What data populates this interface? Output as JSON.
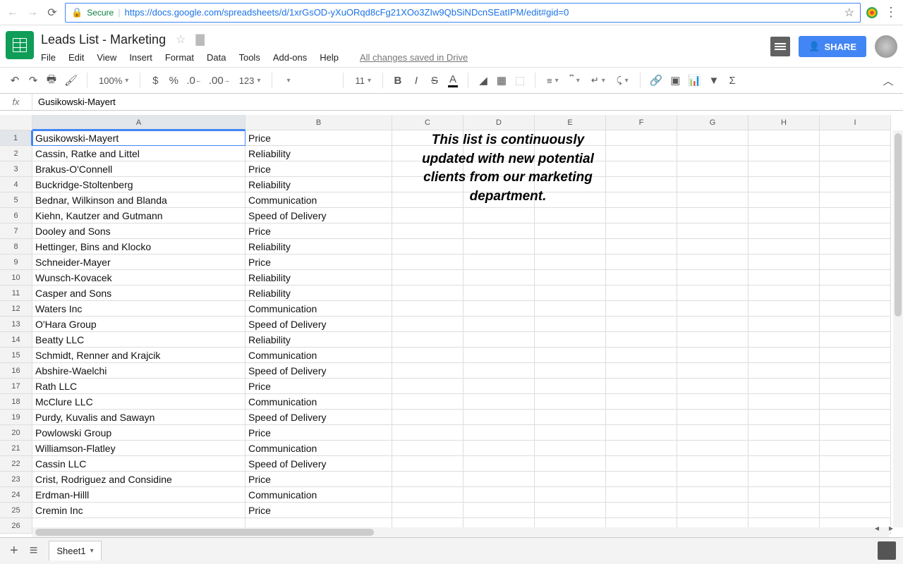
{
  "browser": {
    "secure_label": "Secure",
    "url": "https://docs.google.com/spreadsheets/d/1xrGsOD-yXuORqd8cFg21XOo3ZIw9QbSiNDcnSEatIPM/edit#gid=0"
  },
  "doc": {
    "title": "Leads List - Marketing",
    "menus": [
      "File",
      "Edit",
      "View",
      "Insert",
      "Format",
      "Data",
      "Tools",
      "Add-ons",
      "Help"
    ],
    "save_status": "All changes saved in Drive",
    "share_label": "SHARE"
  },
  "toolbar": {
    "zoom": "100%",
    "currency": "$",
    "percent": "%",
    "dec_dec": ".0",
    "inc_dec": ".00",
    "num_fmt": "123",
    "font_size": "11"
  },
  "formula_bar": {
    "fx": "fx",
    "value": "Gusikowski-Mayert"
  },
  "columns": [
    "A",
    "B",
    "C",
    "D",
    "E",
    "F",
    "G",
    "H",
    "I"
  ],
  "rows": [
    {
      "n": 1,
      "a": "Gusikowski-Mayert",
      "b": "Price"
    },
    {
      "n": 2,
      "a": "Cassin, Ratke and Littel",
      "b": "Reliability"
    },
    {
      "n": 3,
      "a": "Brakus-O'Connell",
      "b": "Price"
    },
    {
      "n": 4,
      "a": "Buckridge-Stoltenberg",
      "b": "Reliability"
    },
    {
      "n": 5,
      "a": "Bednar, Wilkinson and Blanda",
      "b": "Communication"
    },
    {
      "n": 6,
      "a": "Kiehn, Kautzer and Gutmann",
      "b": "Speed of Delivery"
    },
    {
      "n": 7,
      "a": "Dooley and Sons",
      "b": "Price"
    },
    {
      "n": 8,
      "a": "Hettinger, Bins and Klocko",
      "b": "Reliability"
    },
    {
      "n": 9,
      "a": "Schneider-Mayer",
      "b": "Price"
    },
    {
      "n": 10,
      "a": "Wunsch-Kovacek",
      "b": "Reliability"
    },
    {
      "n": 11,
      "a": "Casper and Sons",
      "b": "Reliability"
    },
    {
      "n": 12,
      "a": "Waters Inc",
      "b": "Communication"
    },
    {
      "n": 13,
      "a": "O'Hara Group",
      "b": "Speed of Delivery"
    },
    {
      "n": 14,
      "a": "Beatty LLC",
      "b": "Reliability"
    },
    {
      "n": 15,
      "a": "Schmidt, Renner and Krajcik",
      "b": "Communication"
    },
    {
      "n": 16,
      "a": "Abshire-Waelchi",
      "b": "Speed of Delivery"
    },
    {
      "n": 17,
      "a": "Rath LLC",
      "b": "Price"
    },
    {
      "n": 18,
      "a": "McClure LLC",
      "b": "Communication"
    },
    {
      "n": 19,
      "a": "Purdy, Kuvalis and Sawayn",
      "b": "Speed of Delivery"
    },
    {
      "n": 20,
      "a": "Powlowski Group",
      "b": "Price"
    },
    {
      "n": 21,
      "a": "Williamson-Flatley",
      "b": "Communication"
    },
    {
      "n": 22,
      "a": "Cassin LLC",
      "b": "Speed of Delivery"
    },
    {
      "n": 23,
      "a": "Crist, Rodriguez and Considine",
      "b": "Price"
    },
    {
      "n": 24,
      "a": "Erdman-Hilll",
      "b": "Communication"
    },
    {
      "n": 25,
      "a": "Cremin Inc",
      "b": "Price"
    },
    {
      "n": 26,
      "a": "",
      "b": ""
    }
  ],
  "overlay_note": "This list is continuously updated with new potential clients from our marketing department.",
  "sheet_tab": "Sheet1"
}
